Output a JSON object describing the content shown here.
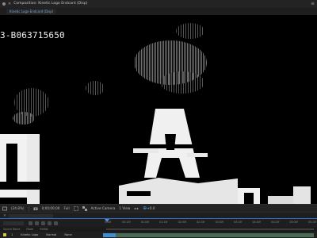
{
  "panel": {
    "tab_label": "Composition: Kinetic Logo Endcard (Disp)",
    "menu_glyph": "≡",
    "breadcrumb": "Kinetic Logo Endcard (Disp)"
  },
  "viewer": {
    "overlay_code": "3-B063715650"
  },
  "toolbar": {
    "zoom": "(24.8%)",
    "timecode": "0;00;00;00",
    "resolution": "Full",
    "camera": "Active Camera",
    "views": "1 View",
    "exposure": "+0.0"
  },
  "timeline": {
    "ruler_ticks": [
      "0:00f",
      "00:15f",
      "01:00f",
      "01:15f",
      "02:00f",
      "02:15f",
      "03:00f",
      "03:15f",
      "04:00f",
      "04:15f",
      "05:00f",
      "05:15f"
    ],
    "columns": [
      "Source Name",
      "Mode",
      "TrkMat"
    ],
    "layer": {
      "number": "1",
      "name": "Kinetic Logo",
      "mode": "Normal",
      "trkmat": "None"
    }
  },
  "colors": {
    "accent_blue": "#2f6fcc",
    "layer_bar": "#4a6b56",
    "layer_label": "#d4c04a"
  }
}
